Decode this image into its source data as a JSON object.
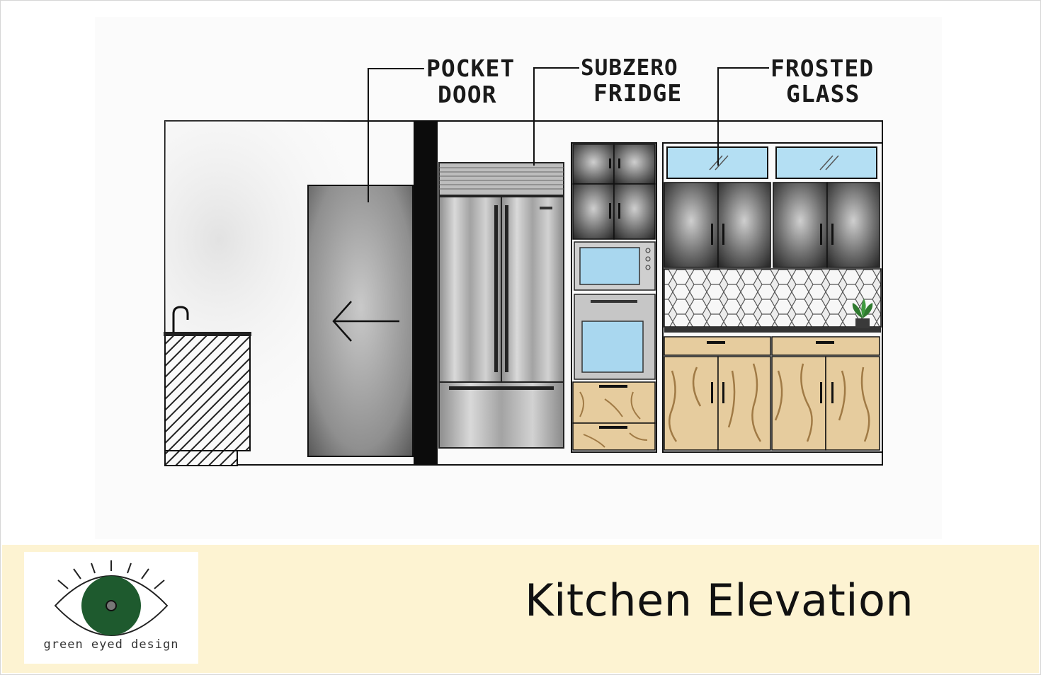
{
  "drawing": {
    "callouts": {
      "pocket_door": [
        "POCKET",
        "DOOR"
      ],
      "subzero_fridge": [
        "SUBZERO",
        "FRIDGE"
      ],
      "frosted_glass": [
        "FROSTED",
        "GLASS"
      ]
    }
  },
  "footer": {
    "logo_text": "green eyed design",
    "title": "Kitchen Elevation"
  },
  "colors": {
    "logo_green": "#1e5a2e",
    "footer_bg": "#fdf3d2",
    "wood": "#e6cc9e",
    "glass": "#a9d7ef"
  }
}
